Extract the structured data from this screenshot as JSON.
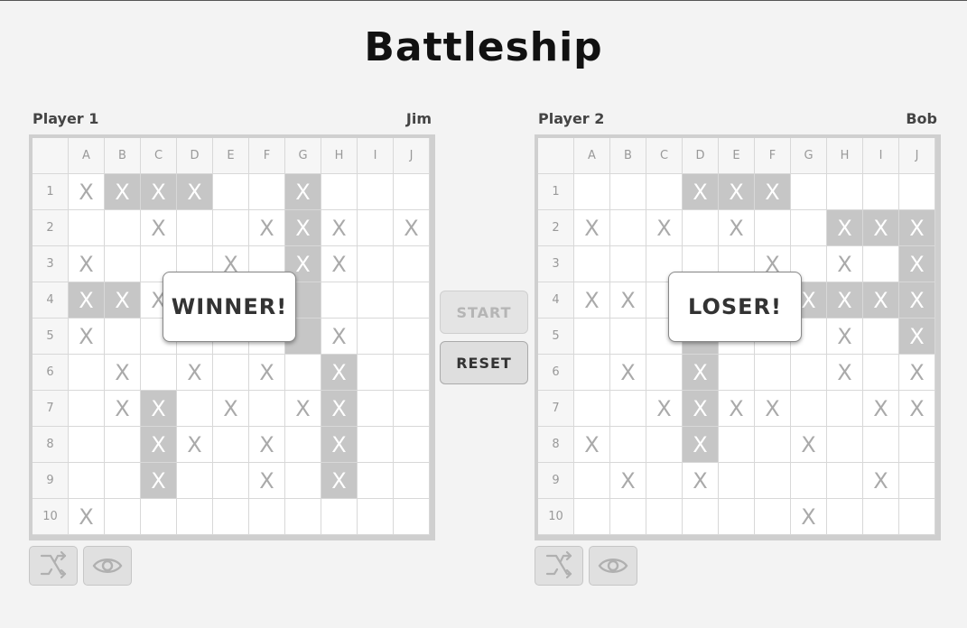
{
  "title": "Battleship",
  "columns": [
    "A",
    "B",
    "C",
    "D",
    "E",
    "F",
    "G",
    "H",
    "I",
    "J"
  ],
  "rows": [
    "1",
    "2",
    "3",
    "4",
    "5",
    "6",
    "7",
    "8",
    "9",
    "10"
  ],
  "controls": {
    "start_label": "START",
    "reset_label": "RESET"
  },
  "players": [
    {
      "label": "Player 1",
      "name": "Jim",
      "result": "WINNER!",
      "ships": [
        "B1",
        "C1",
        "D1",
        "G1",
        "G2",
        "G3",
        "G4",
        "G5",
        "A4",
        "B4",
        "C7",
        "C8",
        "C9",
        "H6",
        "H7",
        "H8",
        "H9"
      ],
      "marks": [
        "A1",
        "B1",
        "C1",
        "D1",
        "G1",
        "C2",
        "F2",
        "G2",
        "H2",
        "J2",
        "A3",
        "E3",
        "G3",
        "H3",
        "A4",
        "B4",
        "C4",
        "F4",
        "A5",
        "H5",
        "B6",
        "D6",
        "F6",
        "H6",
        "B7",
        "C7",
        "E7",
        "G7",
        "H7",
        "C8",
        "D8",
        "F8",
        "H8",
        "C9",
        "F9",
        "H9",
        "A10"
      ]
    },
    {
      "label": "Player 2",
      "name": "Bob",
      "result": "LOSER!",
      "ships": [
        "D1",
        "E1",
        "F1",
        "H2",
        "I2",
        "J2",
        "J3",
        "J4",
        "J5",
        "G4",
        "H4",
        "I4",
        "D4",
        "D5",
        "D6",
        "D7",
        "D8"
      ],
      "marks": [
        "D1",
        "E1",
        "F1",
        "A2",
        "C2",
        "E2",
        "H2",
        "I2",
        "J2",
        "F3",
        "H3",
        "J3",
        "A4",
        "B4",
        "D4",
        "F4",
        "G4",
        "H4",
        "I4",
        "J4",
        "H5",
        "J5",
        "B6",
        "D6",
        "H6",
        "J6",
        "C7",
        "D7",
        "E7",
        "F7",
        "I7",
        "J7",
        "A8",
        "D8",
        "G8",
        "B9",
        "D9",
        "I9",
        "G10"
      ]
    }
  ],
  "icons": {
    "shuffle": "shuffle-icon",
    "reveal": "eye-icon"
  }
}
